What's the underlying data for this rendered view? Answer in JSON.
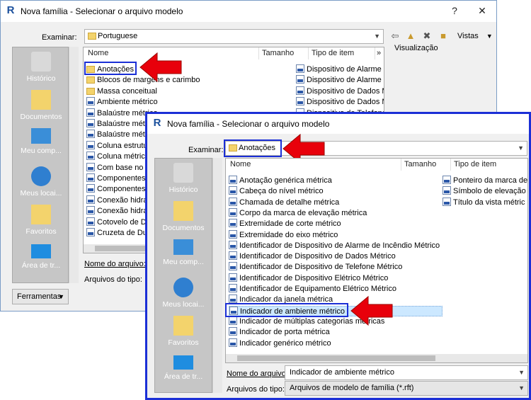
{
  "back_dialog": {
    "title": "Nova família - Selecionar o arquivo modelo",
    "help": "?",
    "close": "✕",
    "look_in_label": "Examinar:",
    "look_in_value": "Portuguese",
    "views_label": "Vistas",
    "preview_label": "Visualização",
    "columns": [
      "Nome",
      "Tamanho",
      "Tipo de item"
    ],
    "more_cols": "»",
    "places": [
      "Histórico",
      "Documentos",
      "Meu comp...",
      "Meus locai...",
      "Favoritos",
      "Área de tr..."
    ],
    "items": [
      {
        "name": "Anotações",
        "icon": "folder"
      },
      {
        "name": "Blocos de margens e carimbo",
        "icon": "folder"
      },
      {
        "name": "Massa conceitual",
        "icon": "folder"
      },
      {
        "name": "Ambiente métrico",
        "icon": "rft"
      },
      {
        "name": "Balaústre métrico",
        "icon": "rft"
      },
      {
        "name": "Balaústre métr",
        "icon": "rft"
      },
      {
        "name": "Balaústre métr",
        "icon": "rft"
      },
      {
        "name": "Coluna estrutu",
        "icon": "rft"
      },
      {
        "name": "Coluna métric",
        "icon": "rft"
      },
      {
        "name": "Com base no",
        "icon": "rft"
      },
      {
        "name": "Componentes",
        "icon": "rft"
      },
      {
        "name": "Componentes",
        "icon": "rft"
      },
      {
        "name": "Conexão hidra",
        "icon": "rft"
      },
      {
        "name": "Conexão hidra",
        "icon": "rft"
      },
      {
        "name": "Cotovelo de D",
        "icon": "rft"
      },
      {
        "name": "Cruzeta de Du",
        "icon": "rft"
      }
    ],
    "types": [
      "Dispositivo de Alarme d",
      "Dispositivo de Alarme d",
      "Dispositivo de Dados M",
      "Dispositivo de Dados M",
      "Dispositivo de Telefone"
    ],
    "filename_label": "Nome do arquivo:",
    "filetype_label": "Arquivos do tipo:",
    "tools_label": "Ferramentas"
  },
  "front_dialog": {
    "title": "Nova família - Selecionar o arquivo modelo",
    "look_in_label": "Examinar:",
    "look_in_value": "Anotações",
    "columns": [
      "Nome",
      "Tamanho",
      "Tipo de item"
    ],
    "places": [
      "Histórico",
      "Documentos",
      "Meu comp...",
      "Meus locai...",
      "Favoritos",
      "Área de tr..."
    ],
    "items": [
      "Anotação genérica métrica",
      "Cabeça do nível métrico",
      "Chamada de detalhe métrica",
      "Corpo da marca de elevação métrica",
      "Extremidade de corte métrico",
      "Extremidade do eixo métrico",
      "Identificador de Dispositivo de Alarme de Incêndio Métrico",
      "Identificador de Dispositivo de Dados Métrico",
      "Identificador de Dispositivo de Telefone Métrico",
      "Identificador de Dispositivo Elétrico Métrico",
      "Identificador de Equipamento Elétrico Métrico",
      "Indicador da janela métrica",
      "Indicador de ambiente métrico",
      "Indicador de múltiplas categorias métricas",
      "Indicador de porta métrica",
      "Indicador genérico métrico"
    ],
    "selected_index": 12,
    "right_items": [
      "Ponteiro da marca de",
      "Símbolo de elevação",
      "Título da vista métric"
    ],
    "filename_label": "Nome do arquivo:",
    "filename_value": "Indicador de ambiente métrico",
    "filetype_label": "Arquivos do tipo:",
    "filetype_value": "Arquivos de modelo de família  (*.rft)"
  },
  "colors": {
    "highlight_box": "#1b2fd6",
    "arrow": "#e8000b",
    "selection": "#cce8ff",
    "places_bg": "#c6c6c6"
  }
}
